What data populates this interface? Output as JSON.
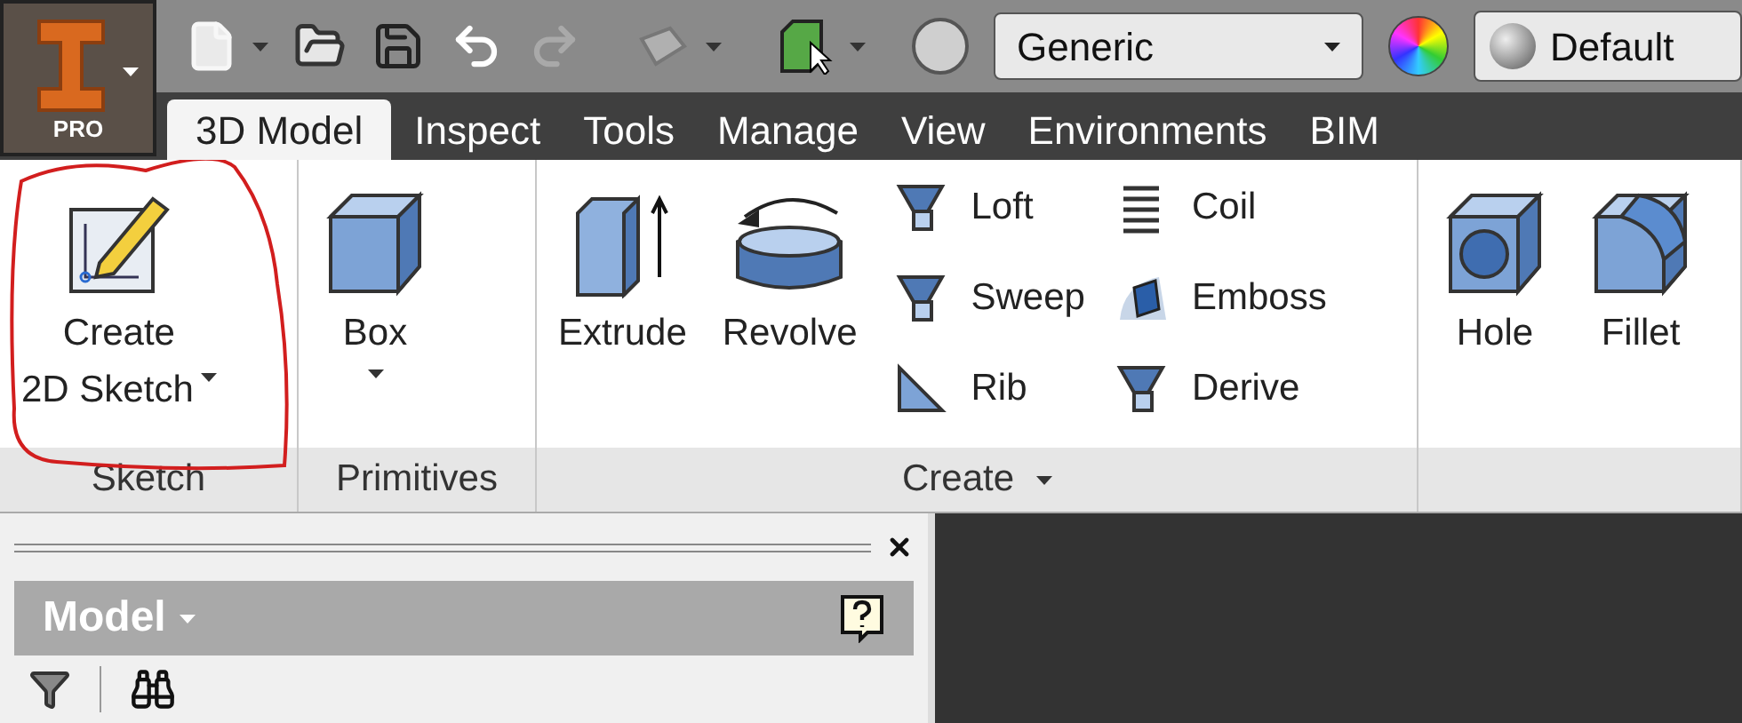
{
  "app_button": {
    "label": "PRO"
  },
  "quick_access": {
    "material": "Generic",
    "appearance": "Default"
  },
  "tabs": [
    {
      "label": "3D Model",
      "selected": true
    },
    {
      "label": "Inspect",
      "selected": false
    },
    {
      "label": "Tools",
      "selected": false
    },
    {
      "label": "Manage",
      "selected": false
    },
    {
      "label": "View",
      "selected": false
    },
    {
      "label": "Environments",
      "selected": false
    },
    {
      "label": "BIM",
      "selected": false
    }
  ],
  "panels": [
    {
      "title": "Sketch",
      "has_menu": false,
      "tools": [
        {
          "kind": "large",
          "lines": [
            "Create",
            "2D Sketch"
          ],
          "dropdown": true
        }
      ]
    },
    {
      "title": "Primitives",
      "has_menu": false,
      "tools": [
        {
          "kind": "large",
          "lines": [
            "Box"
          ],
          "dropdown": true
        }
      ]
    },
    {
      "title": "Create",
      "has_menu": true,
      "tools": [
        {
          "kind": "large",
          "lines": [
            "Extrude"
          ],
          "dropdown": false
        },
        {
          "kind": "large",
          "lines": [
            "Revolve"
          ],
          "dropdown": false
        },
        {
          "kind": "small",
          "lines": [
            "Loft"
          ],
          "dropdown": false
        },
        {
          "kind": "small",
          "lines": [
            "Sweep"
          ],
          "dropdown": false
        },
        {
          "kind": "small",
          "lines": [
            "Rib"
          ],
          "dropdown": false
        },
        {
          "kind": "small",
          "lines": [
            "Coil"
          ],
          "dropdown": false
        },
        {
          "kind": "small",
          "lines": [
            "Emboss"
          ],
          "dropdown": false
        },
        {
          "kind": "small",
          "lines": [
            "Derive"
          ],
          "dropdown": false
        }
      ]
    },
    {
      "has_menu": false,
      "tools": [
        {
          "kind": "large",
          "lines": [
            "Hole"
          ],
          "dropdown": false
        },
        {
          "kind": "large",
          "lines": [
            "Fillet"
          ],
          "dropdown": false
        }
      ]
    }
  ],
  "browser": {
    "title": "Model"
  }
}
